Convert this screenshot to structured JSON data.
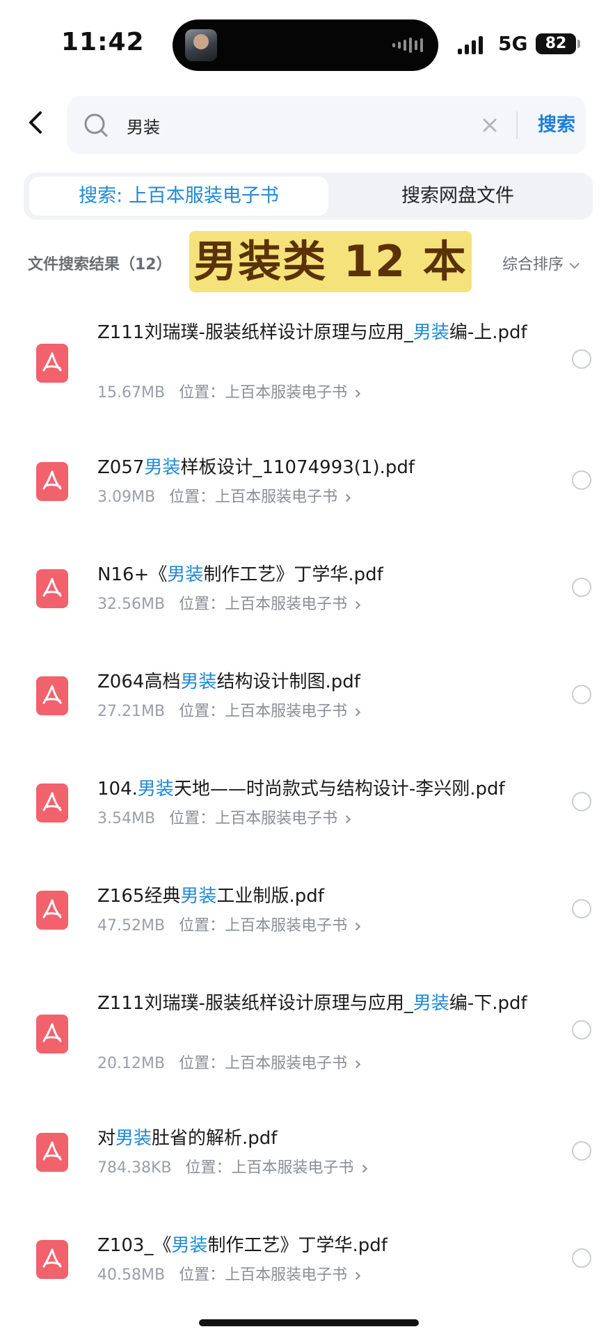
{
  "status_bar": {
    "time": "11:42",
    "network": "5G",
    "battery": "82"
  },
  "header": {
    "search_value": "男装",
    "search_button": "搜索"
  },
  "tabs": [
    {
      "label": "搜索: 上百本服装电子书",
      "active": true
    },
    {
      "label": "搜索网盘文件",
      "active": false
    }
  ],
  "results": {
    "label": "文件搜索结果（12）",
    "sort_label": "综合排序",
    "overlay_text": "男装类 12 本"
  },
  "location_label": "位置：",
  "files": [
    {
      "name_before": "Z111刘瑞璞-服装纸样设计原理与应用_",
      "highlight": "男装",
      "name_after": "编-上.pdf",
      "size": "15.67MB",
      "location": "上百本服装电子书"
    },
    {
      "name_before": "Z057",
      "highlight": "男装",
      "name_after": "样板设计_11074993(1).pdf",
      "size": "3.09MB",
      "location": "上百本服装电子书"
    },
    {
      "name_before": "N16+《",
      "highlight": "男装",
      "name_after": "制作工艺》丁学华.pdf",
      "size": "32.56MB",
      "location": "上百本服装电子书"
    },
    {
      "name_before": "Z064高档",
      "highlight": "男装",
      "name_after": "结构设计制图.pdf",
      "size": "27.21MB",
      "location": "上百本服装电子书"
    },
    {
      "name_before": "104.",
      "highlight": "男装",
      "name_after": "天地——时尚款式与结构设计-李兴刚.pdf",
      "size": "3.54MB",
      "location": "上百本服装电子书"
    },
    {
      "name_before": "Z165经典",
      "highlight": "男装",
      "name_after": "工业制版.pdf",
      "size": "47.52MB",
      "location": "上百本服装电子书"
    },
    {
      "name_before": "Z111刘瑞璞-服装纸样设计原理与应用_",
      "highlight": "男装",
      "name_after": "编-下.pdf",
      "size": "20.12MB",
      "location": "上百本服装电子书"
    },
    {
      "name_before": "对",
      "highlight": "男装",
      "name_after": "肚省的解析.pdf",
      "size": "784.38KB",
      "location": "上百本服装电子书"
    },
    {
      "name_before": "Z103_《",
      "highlight": "男装",
      "name_after": "制作工艺》丁学华.pdf",
      "size": "40.58MB",
      "location": "上百本服装电子书"
    }
  ],
  "colors": {
    "accent": "#1e88d6",
    "pdf_icon": "#f1626c",
    "overlay_bg": "#f6e27a",
    "overlay_text": "#5a3206"
  }
}
